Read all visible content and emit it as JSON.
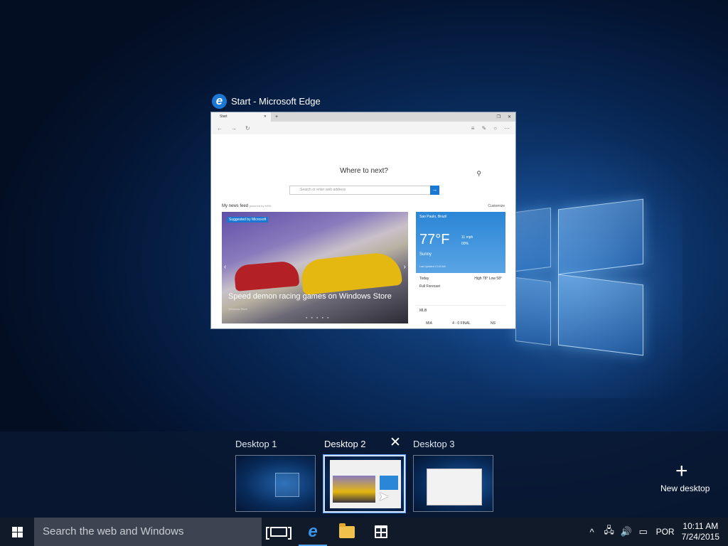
{
  "window": {
    "title": "Start - Microsoft Edge",
    "tab_label": "Start",
    "where_next": "Where to next?",
    "search_placeholder": "Search or enter web address",
    "feed_label": "My news feed",
    "feed_powered": "powered by MSN",
    "customize": "Customize",
    "hero_badge": "Suggested by Microsoft",
    "hero_caption": "Speed demon racing games on Windows Store",
    "hero_source": "Windows Store",
    "weather": {
      "city": "Sao Paulo, Brazil",
      "temp": "77°F",
      "wind": "11 mph",
      "humidity": "00%",
      "condition": "Sunny",
      "updated": "Last Updated 10:45 AM",
      "today": "Today",
      "hilo": "High 78° Low 58°",
      "forecast": "Full Forecast"
    },
    "mlb": {
      "title": "MLB",
      "team1": "MIA",
      "score": "4 - 0",
      "status": "FINAL",
      "team2": "NS"
    }
  },
  "taskview": {
    "desktops": [
      {
        "label": "Desktop 1"
      },
      {
        "label": "Desktop 2"
      },
      {
        "label": "Desktop 3"
      }
    ],
    "close_glyph": "✕",
    "new_desktop_glyph": "+",
    "new_desktop_label": "New desktop"
  },
  "taskbar": {
    "search_placeholder": "Search the web and Windows",
    "edge_glyph": "e",
    "tray": {
      "chevron_glyph": "^",
      "language": "POR",
      "time": "10:11 AM",
      "date": "7/24/2015"
    }
  },
  "colors": {
    "accent": "#1a77d2",
    "taskbar": "#101a29",
    "search_box": "#3d4350"
  }
}
